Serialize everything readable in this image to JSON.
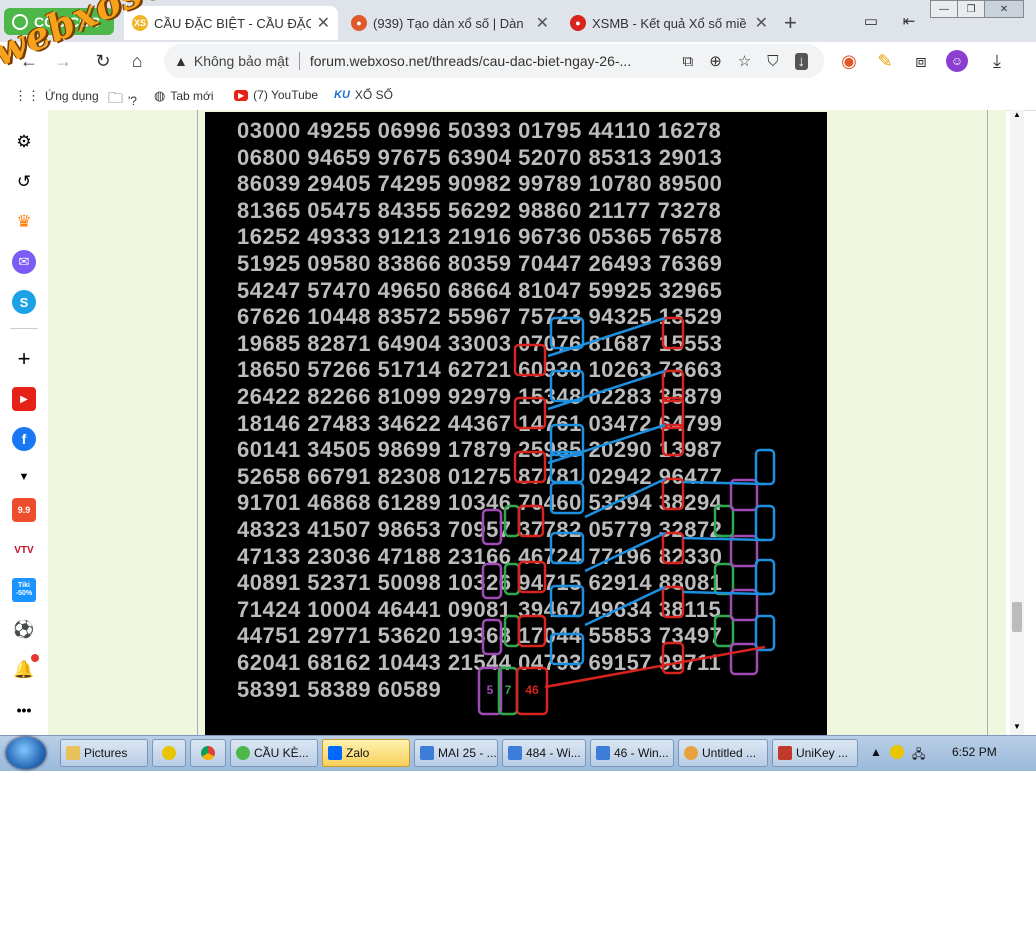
{
  "browser": {
    "brand": "CỐC CỐC",
    "tabs": [
      {
        "title": "CẦU ĐẶC BIỆT - CẦU ĐẶC BIỆT",
        "favicon": "xs-icon",
        "active": true
      },
      {
        "title": "(939) Tạo dàn xổ số | Dàn",
        "favicon": "swirl-icon",
        "active": false
      },
      {
        "title": "XSMB - Kết quả Xổ số miề",
        "favicon": "xsmb-icon",
        "active": false
      }
    ],
    "new_tab_label": "+",
    "security_label": "Không bảo mật",
    "url": "forum.webxoso.net/threads/cau-dac-biet-ngay-26-...",
    "bookmarks": [
      {
        "label": "Ứng dụng",
        "icon": "apps-icon"
      },
      {
        "label": "'?",
        "icon": "folder-icon"
      },
      {
        "label": "Tab mới",
        "icon": "globe-icon"
      },
      {
        "label": "(7) YouTube",
        "icon": "youtube-icon"
      },
      {
        "label": "XỔ SỐ",
        "icon": "ku-icon"
      }
    ]
  },
  "watermark": "webxoso.net",
  "sidebar_icons": [
    "settings-icon",
    "history-icon",
    "crown-icon",
    "messenger-icon",
    "skype-icon",
    "add-icon",
    "youtube-icon",
    "facebook-icon",
    "chevron-down-icon",
    "shopee-icon",
    "vtv-icon",
    "tiki-icon",
    "soccer-icon",
    "bell-icon",
    "more-icon"
  ],
  "sidebar_badges": {
    "shopee": "9.9",
    "vtv": "VTV",
    "tiki": "Tiki -50%"
  },
  "numbers": [
    "03000 49255 06996 50393 01795 44110 16278",
    "06800 94659 97675 63904 52070 85313 29013",
    "86039 29405 74295 90982 99789 10780 89500",
    "81365 05475 84355 56292 98860 21177 73278",
    "16252 49333 91213 21916 96736 05365 76578",
    "51925 09580 83866 80359 70447 26493 76369",
    "54247 57470 49650 68664 81047 59925 32965",
    "67626 10448 83572 55967 75723 94325 13529",
    "19685 82871 64904 33003 07076 81687 15553",
    "18650 57266 51714 62721 60930 10263 73663",
    "26422 82266 81099 92979 15348 02283 35879",
    "18146 27483 34622 44367 14761 03472 64799",
    "60141 34505 98699 17879 25985 20290 13987",
    "52658 66791 82308 01275 87781 02942 96477",
    "91701 46868 61289 10346 70460 53594 38294",
    "48323 41507 98653 70957 37782 05779 32872",
    "47133 23036 47188 23166 46724 77196 82330",
    "40891 52371 50098 10326 94715 62914 88081",
    "71424 10004 46441 09081 39467 49634 38115",
    "44751 29771 53620 19368 17044 55853 73497",
    "62041 68162 10443 21544 04793 69157 98711",
    "58391 58389 60589"
  ],
  "predictions": [
    {
      "label": "5",
      "color": "#a04bb5"
    },
    {
      "label": "7",
      "color": "#2fa84f"
    },
    {
      "label": "46",
      "color": "#d8231f"
    }
  ],
  "taskbar": {
    "items": [
      {
        "label": "Pictures",
        "icon": "folder-icon",
        "active": false
      },
      {
        "label": "",
        "icon": "unikey-plus-icon",
        "active": false
      },
      {
        "label": "",
        "icon": "chrome-icon",
        "active": false
      },
      {
        "label": "CẦU KÈ...",
        "icon": "coccoc-icon",
        "active": false
      },
      {
        "label": "Zalo",
        "icon": "zalo-icon",
        "active": true
      },
      {
        "label": "MAI 25 - ...",
        "icon": "window-icon",
        "active": false
      },
      {
        "label": "484 - Wi...",
        "icon": "window-icon",
        "active": false
      },
      {
        "label": "46 - Win...",
        "icon": "window-icon",
        "active": false
      },
      {
        "label": "Untitled ...",
        "icon": "paint-icon",
        "active": false
      },
      {
        "label": "UniKey ...",
        "icon": "unikey-icon",
        "active": false
      }
    ],
    "clock": "6:52 PM"
  },
  "colors": {
    "red": "#d8231f",
    "blue": "#1d8fe0",
    "green": "#2fa84f",
    "purple": "#a04bb5",
    "page_bg": "#eef7dd"
  }
}
